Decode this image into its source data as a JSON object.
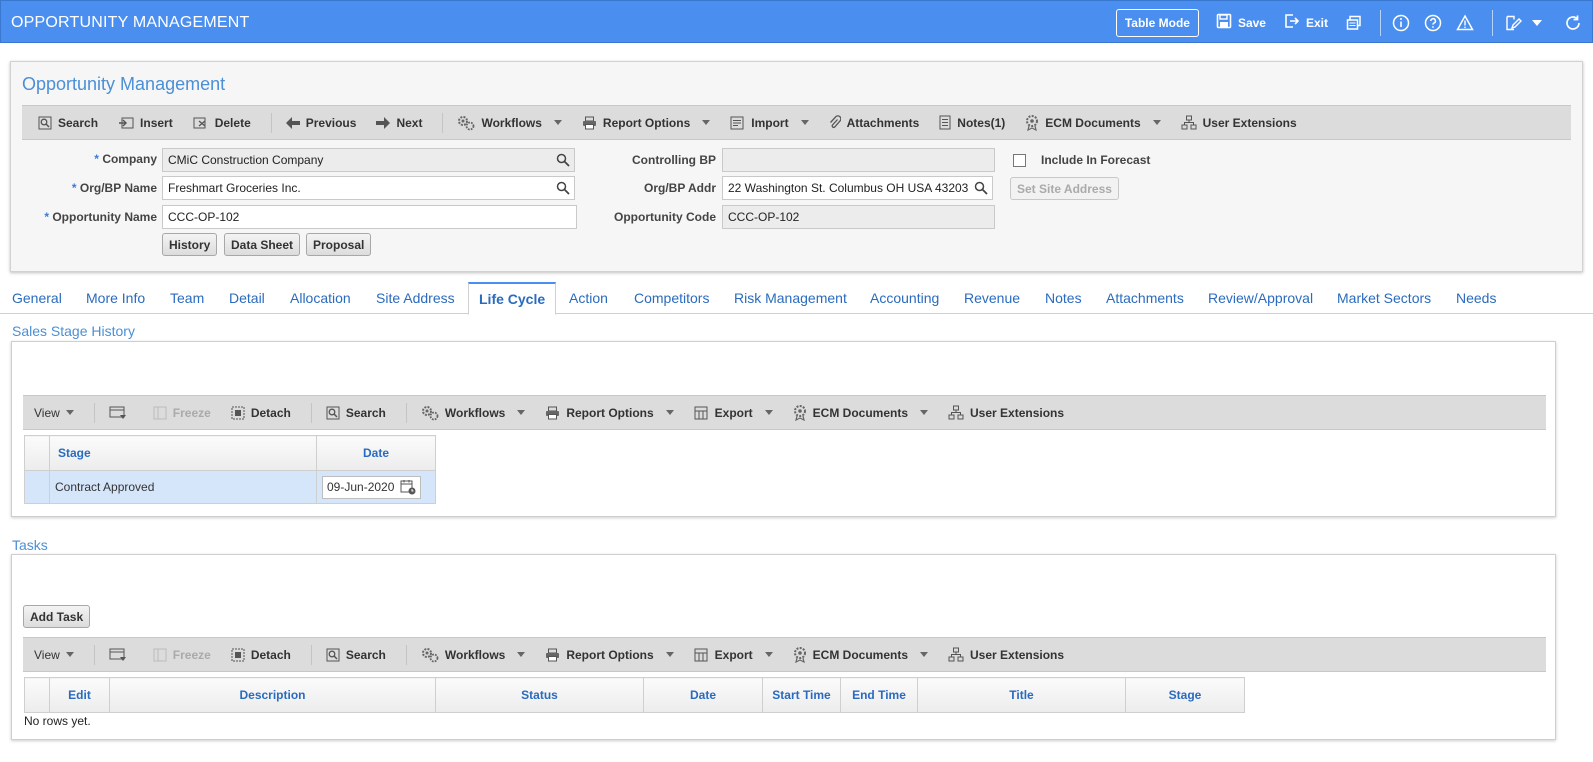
{
  "app": {
    "title": "OPPORTUNITY MANAGEMENT",
    "table_mode": "Table Mode",
    "save": "Save",
    "exit": "Exit"
  },
  "header_panel": {
    "title": "Opportunity Management",
    "toolbar": {
      "search": "Search",
      "insert": "Insert",
      "delete": "Delete",
      "previous": "Previous",
      "next": "Next",
      "workflows": "Workflows",
      "report_options": "Report Options",
      "import": "Import",
      "attachments": "Attachments",
      "notes": "Notes(1)",
      "ecm_documents": "ECM Documents",
      "user_extensions": "User Extensions"
    },
    "fields": {
      "company_label": "Company",
      "company_value": "CMiC Construction Company",
      "org_bp_name_label": "Org/BP Name",
      "org_bp_name_value": "Freshmart Groceries Inc.",
      "opportunity_name_label": "Opportunity Name",
      "opportunity_name_value": "CCC-OP-102",
      "controlling_bp_label": "Controlling BP",
      "controlling_bp_value": "",
      "org_bp_addr_label": "Org/BP Addr",
      "org_bp_addr_value": "22 Washington St.  Columbus OH USA 43203",
      "opportunity_code_label": "Opportunity Code",
      "opportunity_code_value": "CCC-OP-102",
      "include_in_forecast_label": "Include In Forecast",
      "include_in_forecast_checked": false,
      "set_site_address": "Set Site Address",
      "required_marker": "*"
    },
    "buttons": {
      "history": "History",
      "data_sheet": "Data Sheet",
      "proposal": "Proposal"
    }
  },
  "tabs": [
    "General",
    "More Info",
    "Team",
    "Detail",
    "Allocation",
    "Site Address",
    "Life Cycle",
    "Action",
    "Competitors",
    "Risk Management",
    "Accounting",
    "Revenue",
    "Notes",
    "Attachments",
    "Review/Approval",
    "Market Sectors",
    "Needs"
  ],
  "active_tab": "Life Cycle",
  "grid_toolbar": {
    "view": "View",
    "freeze": "Freeze",
    "detach": "Detach",
    "search": "Search",
    "workflows": "Workflows",
    "report_options": "Report Options",
    "export": "Export",
    "ecm_documents": "ECM Documents",
    "user_extensions": "User Extensions"
  },
  "sales_stage_history": {
    "title": "Sales Stage History",
    "columns": [
      "Stage",
      "Date"
    ],
    "rows": [
      {
        "stage": "Contract Approved",
        "date": "09-Jun-2020"
      }
    ]
  },
  "tasks": {
    "title": "Tasks",
    "add_task": "Add Task",
    "columns": [
      "Edit",
      "Description",
      "Status",
      "Date",
      "Start Time",
      "End Time",
      "Title",
      "Stage"
    ],
    "empty_text": "No rows yet."
  },
  "colors": {
    "topbar": "#4a8ff0",
    "accent_blue": "#4b8fd6",
    "selected_row": "#d6e6fa"
  }
}
